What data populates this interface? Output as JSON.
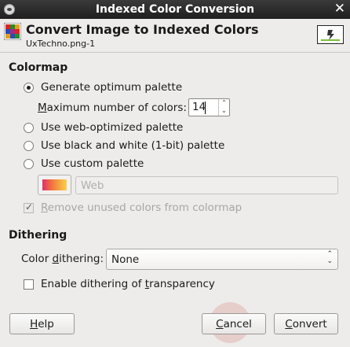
{
  "window": {
    "title": "Indexed Color Conversion",
    "close_glyph": "✕"
  },
  "header": {
    "title": "Convert Image to Indexed Colors",
    "subtitle": "UxTechno.png-1"
  },
  "colormap": {
    "section_title": "Colormap",
    "generate_optimum": {
      "label": "Generate optimum palette",
      "selected": true
    },
    "max_colors": {
      "label_prefix": "M",
      "label_rest": "aximum number of colors:",
      "value": "14"
    },
    "web_optimized": {
      "label": "Use web-optimized palette",
      "selected": false
    },
    "black_white": {
      "label": "Use black and white (1-bit) palette",
      "selected": false
    },
    "custom_palette": {
      "label": "Use custom palette",
      "selected": false
    },
    "palette_name": "Web",
    "remove_unused": {
      "label_prefix": "R",
      "label_rest": "emove unused colors from colormap",
      "checked": true,
      "enabled": false
    }
  },
  "dithering": {
    "section_title": "Dithering",
    "color_dithering_label_a": "Color ",
    "color_dithering_label_u": "d",
    "color_dithering_label_b": "ithering:",
    "color_dithering_value": "None",
    "transparency": {
      "label_a": "Enable dithering of ",
      "label_u": "t",
      "label_b": "ransparency",
      "checked": false
    }
  },
  "buttons": {
    "help_u": "H",
    "help_rest": "elp",
    "cancel_u": "C",
    "cancel_rest": "ancel",
    "convert_u": "C",
    "convert_rest": "onvert"
  },
  "icons": {
    "window": "window-menu-icon",
    "app": "indexed-color-icon",
    "thumbnail": "image-thumbnail-icon"
  },
  "colors": {
    "titlebar": "#2a2a2a",
    "background": "#edeceb",
    "disabled_text": "#a8a6a2"
  }
}
